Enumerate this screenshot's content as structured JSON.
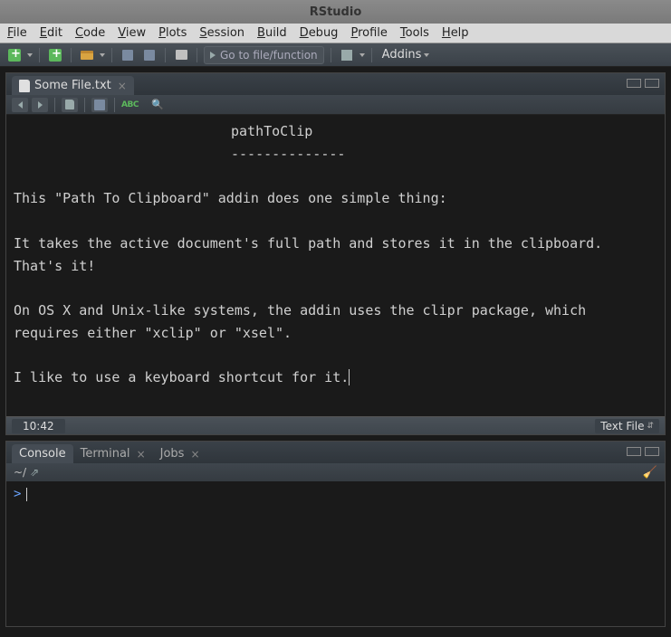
{
  "window": {
    "title": "RStudio"
  },
  "menu": {
    "file": "File",
    "edit": "Edit",
    "code": "Code",
    "view": "View",
    "plots": "Plots",
    "session": "Session",
    "build": "Build",
    "debug": "Debug",
    "profile": "Profile",
    "tools": "Tools",
    "help": "Help"
  },
  "toolbar": {
    "goto_placeholder": "Go to file/function",
    "addins_label": "Addins"
  },
  "editor": {
    "tab_label": "Some File.txt",
    "title_line": "pathToClip",
    "rule_line": "--------------",
    "para1": "This \"Path To Clipboard\" addin does one simple thing:",
    "para2": "It takes the active document's full path and stores it in the clipboard. That's it!",
    "para3": "On OS X and Unix-like systems, the addin uses the clipr package, which requires either \"xclip\" or \"xsel\".",
    "para4": "I like to use a keyboard shortcut for it."
  },
  "status": {
    "position": "10:42",
    "filetype": "Text File"
  },
  "console": {
    "tabs": {
      "console": "Console",
      "terminal": "Terminal",
      "jobs": "Jobs"
    },
    "cwd": "~/",
    "prompt": ">"
  }
}
